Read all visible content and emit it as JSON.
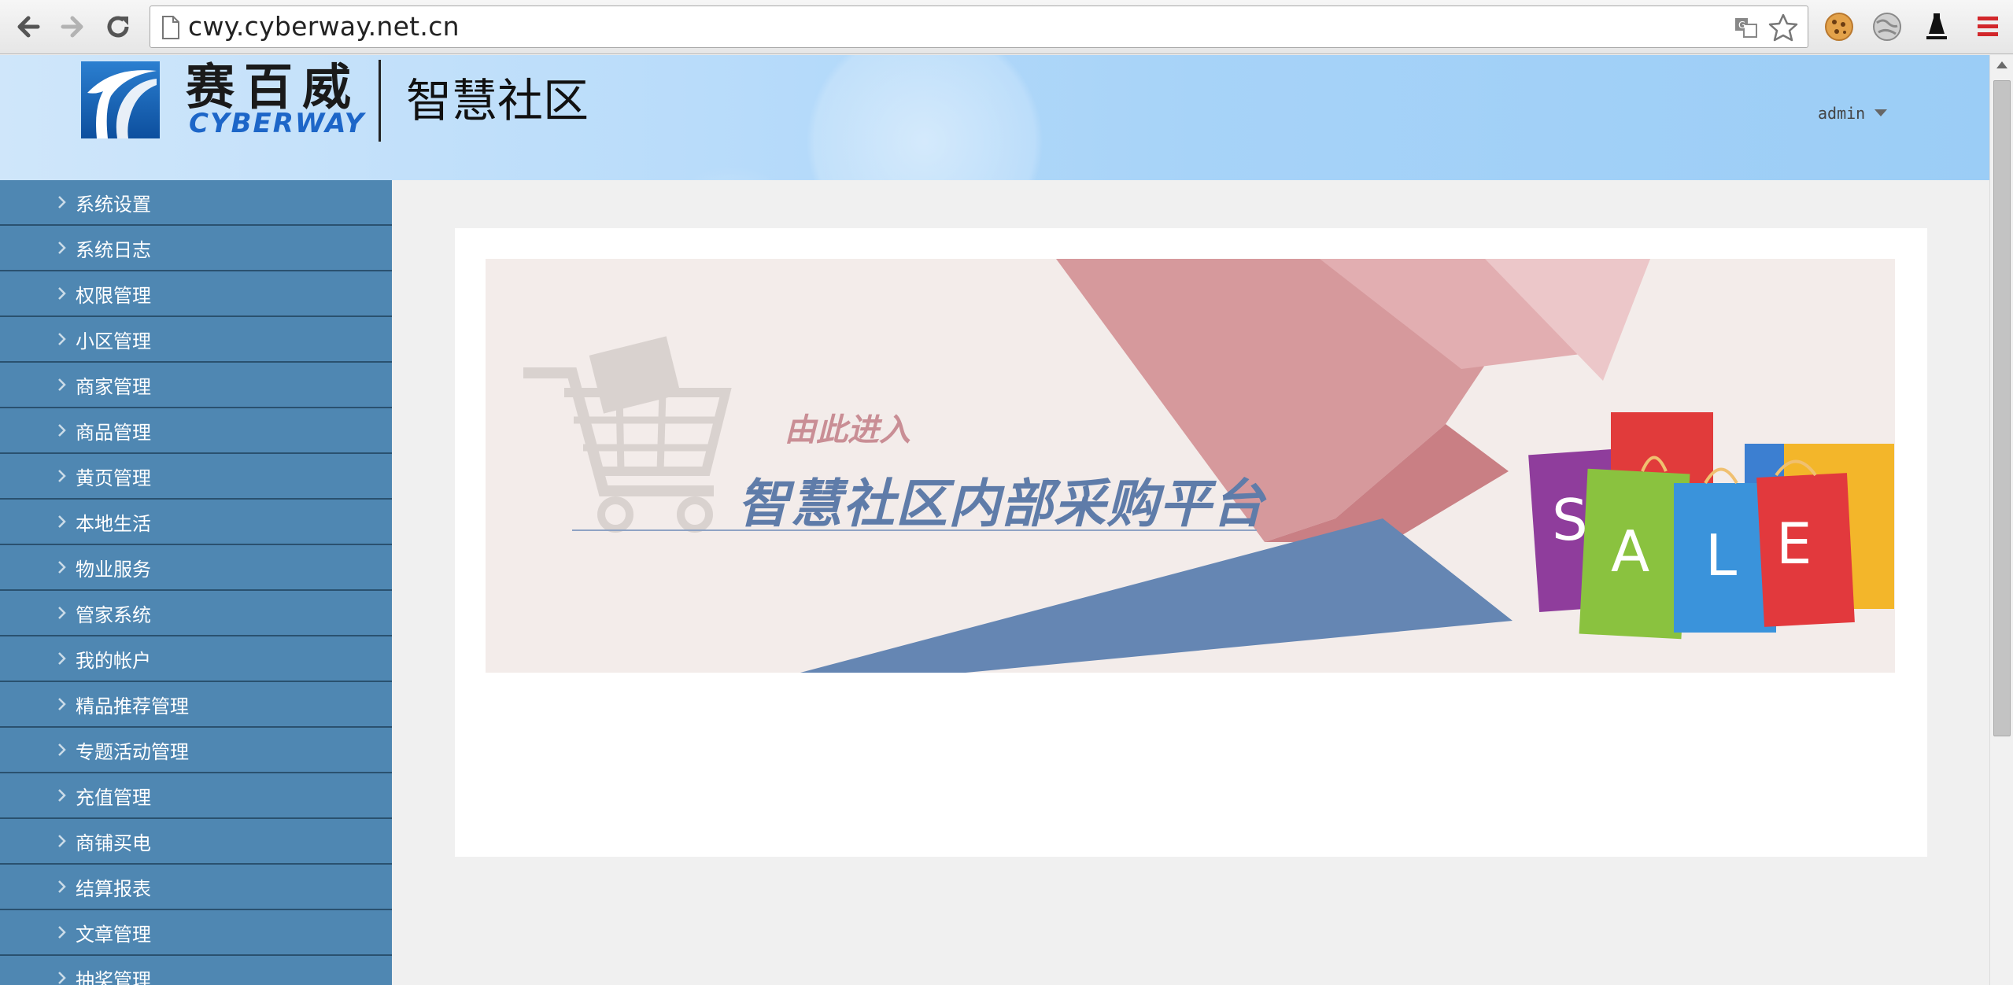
{
  "browser": {
    "url": "cwy.cyberway.net.cn",
    "icons": [
      "back-icon",
      "forward-icon",
      "reload-icon",
      "page-icon",
      "translate-icon",
      "star-icon",
      "cookie-icon",
      "globe-icon",
      "extension-icon",
      "menu-icon"
    ]
  },
  "header": {
    "logo_cn": "赛百威",
    "logo_en": "CYBERWAY",
    "site_title": "智慧社区",
    "user": "admin"
  },
  "sidebar": {
    "items": [
      {
        "label": "系统设置"
      },
      {
        "label": "系统日志"
      },
      {
        "label": "权限管理"
      },
      {
        "label": "小区管理"
      },
      {
        "label": "商家管理"
      },
      {
        "label": "商品管理"
      },
      {
        "label": "黄页管理"
      },
      {
        "label": "本地生活"
      },
      {
        "label": "物业服务"
      },
      {
        "label": "管家系统"
      },
      {
        "label": "我的帐户"
      },
      {
        "label": "精品推荐管理"
      },
      {
        "label": "专题活动管理"
      },
      {
        "label": "充值管理"
      },
      {
        "label": "商铺买电"
      },
      {
        "label": "结算报表"
      },
      {
        "label": "文章管理"
      },
      {
        "label": "抽奖管理"
      }
    ]
  },
  "banner": {
    "subtitle": "由此进入",
    "title": "智慧社区内部采购平台",
    "sale_letters": [
      "S",
      "A",
      "L",
      "E"
    ]
  },
  "colors": {
    "sidebar_bg": "#4f87b2",
    "sidebar_border": "#2a516f",
    "header_bg": "#a7d3f8",
    "banner_blue": "#5f7ca9",
    "banner_pink": "#d6999c"
  }
}
